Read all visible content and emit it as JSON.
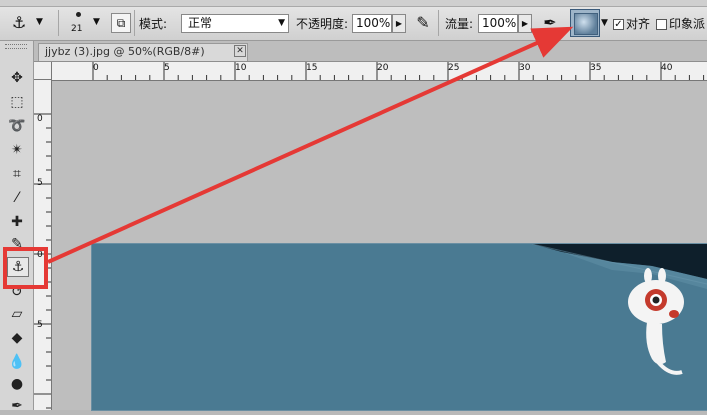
{
  "options_bar": {
    "brush_size": "21",
    "mode_label": "模式:",
    "mode_value": "正常",
    "opacity_label": "不透明度:",
    "opacity_value": "100%",
    "flow_label": "流量:",
    "flow_value": "100%",
    "aligned_label": "对齐",
    "aligned_checked": true,
    "impressionist_label": "印象派",
    "impressionist_checked": false
  },
  "document": {
    "tab_title": "jjybz (3).jpg @ 50%(RGB/8#)",
    "close_glyph": "✕"
  },
  "rulers": {
    "horizontal": [
      "0",
      "5",
      "10",
      "15",
      "20",
      "25",
      "30",
      "35",
      "40"
    ],
    "vertical": [
      "0",
      "5",
      "0",
      "5"
    ]
  },
  "annotation": {
    "highlight_color": "#e53935",
    "arrow_color": "#e53935"
  },
  "icons": {
    "clone_stamp": "clone-stamp-icon",
    "sample_all_layers": "sample-all-layers-icon"
  }
}
